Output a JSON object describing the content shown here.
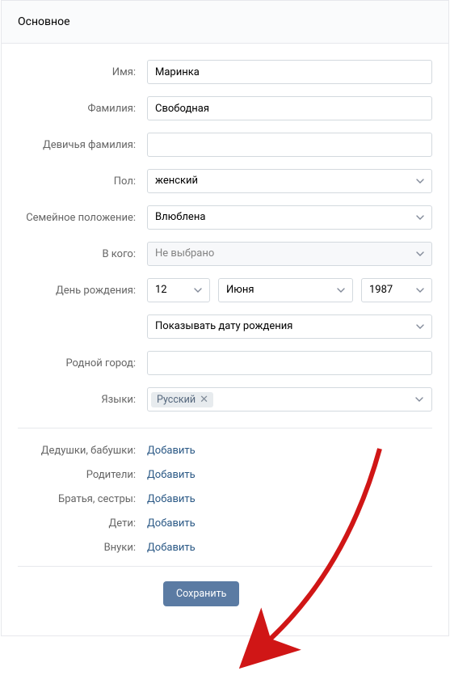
{
  "header": {
    "title": "Основное"
  },
  "fields": {
    "first_name": {
      "label": "Имя:",
      "value": "Маринка"
    },
    "last_name": {
      "label": "Фамилия:",
      "value": "Свободная"
    },
    "maiden_name": {
      "label": "Девичья фамилия:",
      "value": ""
    },
    "gender": {
      "label": "Пол:",
      "value": "женский"
    },
    "relationship": {
      "label": "Семейное положение:",
      "value": "Влюблена"
    },
    "partner": {
      "label": "В кого:",
      "value": "Не выбрано"
    },
    "birthday": {
      "label": "День рождения:",
      "day": "12",
      "month": "Июня",
      "year": "1987",
      "visibility": "Показывать дату рождения"
    },
    "hometown": {
      "label": "Родной город:",
      "value": ""
    },
    "languages": {
      "label": "Языки:",
      "tag": "Русский"
    }
  },
  "relatives": {
    "grandparents": {
      "label": "Дедушки, бабушки:",
      "action": "Добавить"
    },
    "parents": {
      "label": "Родители:",
      "action": "Добавить"
    },
    "siblings": {
      "label": "Братья, сестры:",
      "action": "Добавить"
    },
    "children": {
      "label": "Дети:",
      "action": "Добавить"
    },
    "grandchildren": {
      "label": "Внуки:",
      "action": "Добавить"
    }
  },
  "footer": {
    "save": "Сохранить"
  }
}
